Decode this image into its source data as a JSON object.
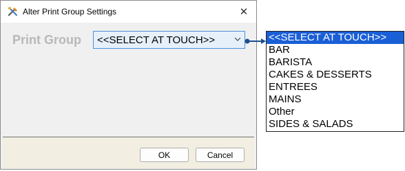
{
  "dialog": {
    "title": "Alter Print Group Settings",
    "close_symbol": "✕",
    "app_icon": "tools-icon"
  },
  "form": {
    "print_group_label": "Print Group",
    "print_group_value": "<<SELECT AT TOUCH>>"
  },
  "buttons": {
    "ok": "OK",
    "cancel": "Cancel"
  },
  "dropdown": {
    "items": [
      "<<SELECT AT TOUCH>>",
      "BAR",
      "BARISTA",
      "CAKES & DESSERTS",
      "ENTREES",
      "MAINS",
      "Other",
      "SIDES & SALADS"
    ],
    "selected_index": 0
  },
  "colors": {
    "selection": "#1a5fd6",
    "footer": "#f2efe2",
    "combo_border": "#4a8fd9",
    "connector": "#1a4f8a"
  }
}
